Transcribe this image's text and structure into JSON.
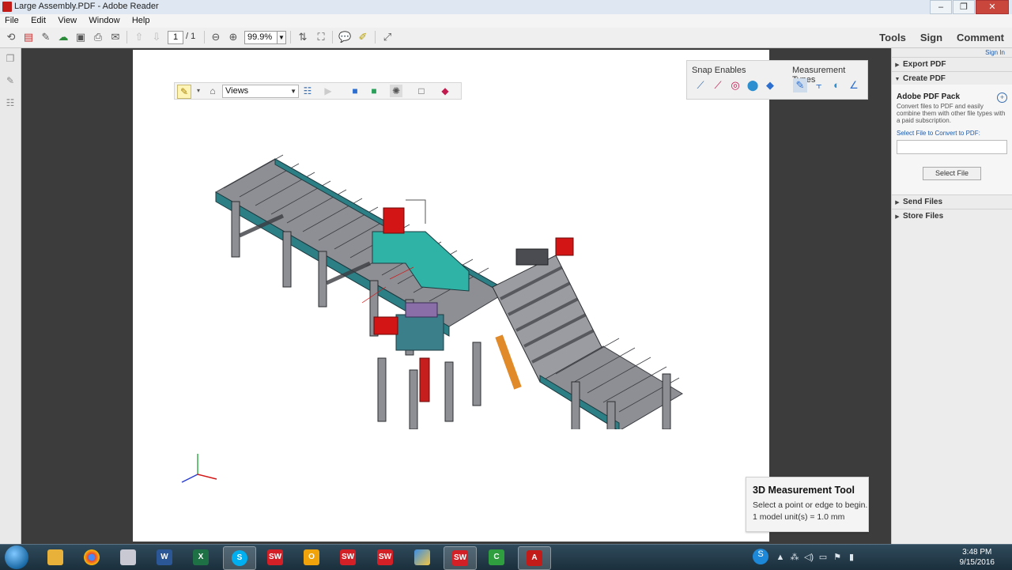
{
  "window": {
    "title": "Large Assembly.PDF - Adobe Reader",
    "controls": [
      "–",
      "❐",
      "✕"
    ]
  },
  "menu": [
    "File",
    "Edit",
    "View",
    "Window",
    "Help"
  ],
  "toolbar": {
    "page_current": "1",
    "page_total": "/ 1",
    "zoom": "99.9%",
    "right_links": [
      "Tools",
      "Sign",
      "Comment"
    ]
  },
  "toolbar_3d": {
    "views_label": "Views"
  },
  "measurement_panel": {
    "snap_label": "Snap Enables",
    "types_label": "Measurement Types"
  },
  "measurement_tip": {
    "title": "3D Measurement Tool",
    "line1": "Select a point or edge to begin.",
    "line2": "1 model unit(s) = 1.0 mm"
  },
  "right_pane": {
    "sign_in": "Sign In",
    "sections": [
      "Export PDF",
      "Create PDF",
      "Send Files",
      "Store Files"
    ],
    "create": {
      "heading": "Adobe PDF Pack",
      "desc": "Convert files to PDF and easily combine them with other file types with a paid subscription.",
      "select_label": "Select File to Convert to PDF:",
      "button": "Select File"
    }
  },
  "taskbar": {
    "apps": [
      "Explorer",
      "Chrome",
      "Paint",
      "Word",
      "Excel",
      "Skype",
      "SolidWorks",
      "Outlook",
      "SW 2015",
      "SW 2016",
      "Messenger",
      "SW 2016",
      "Camtasia",
      "Adobe Reader"
    ],
    "time": "3:48 PM",
    "date": "9/15/2016"
  },
  "colors": {
    "accent_red": "#d31515",
    "teal": "#2fb3a6",
    "conveyor_gray": "#8d8f94"
  }
}
